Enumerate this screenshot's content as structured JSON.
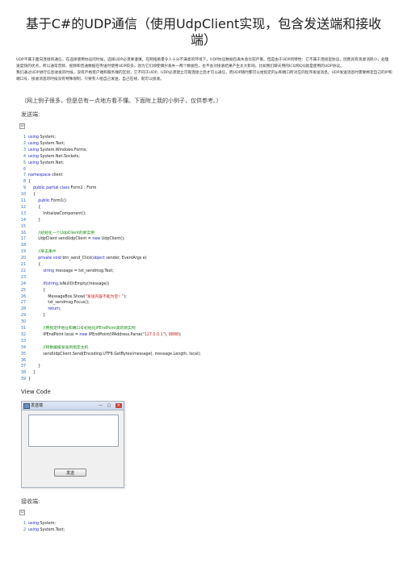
{
  "document": {
    "title": "基于C#的UDP通信（使用UdpClient实现，包含发送端和接收端）",
    "intro": [
      "UDP不属于面向连接的通信，在选择使用协议的时候，选择UDP必须要谨慎。在网络质量令人十分不满意的环境下，UDP协议数据包丢失会比较严重。但是由于UDP的特性：它不属于连接型协议，因而具有资源消耗小，处理速度快的优点，所以通常音频、视频和普通数据在传送时使用UDP较多，因为它们即使偶尔丢失一两个数据包，也不会对接收结果产生太大影响。比如我们聊天用的ICQ和QQ就是使用的UDP协议。",
      "我们通过UDP进行信息收发的时候，没有严格客户端和服务端的区别，它不同于UDP，UDP必须建立可靠连接之后才可以通信，而UDP随时都可以给指定的ip和端口所对应的程序发送消息。UDP发送消息时需要绑定自己的IP和端口号，接收消息的时候没有特殊限制，只要有人给自己发送，自己在线，就可以接收。"
    ],
    "note": "（网上例子很多，但是总有一点地方看不懂。下面附上我的小例子，仅供参考。）",
    "sender_label": "发送端:",
    "view_code": "View Code",
    "receiver_label": "接收端:",
    "collapse_symbol": "⊟"
  },
  "sender_code": [
    {
      "n": "1",
      "parts": [
        {
          "t": "kw",
          "s": "using"
        },
        {
          "t": "",
          "s": " System;"
        }
      ]
    },
    {
      "n": "2",
      "parts": [
        {
          "t": "kw",
          "s": "using"
        },
        {
          "t": "",
          "s": " System.Text;"
        }
      ]
    },
    {
      "n": "3",
      "parts": [
        {
          "t": "kw",
          "s": "using"
        },
        {
          "t": "",
          "s": " System.Windows.Forms;"
        }
      ]
    },
    {
      "n": "4",
      "parts": [
        {
          "t": "kw",
          "s": "using"
        },
        {
          "t": "",
          "s": " System.Net.Sockets;"
        }
      ]
    },
    {
      "n": "5",
      "parts": [
        {
          "t": "kw",
          "s": "using"
        },
        {
          "t": "",
          "s": " System.Net;"
        }
      ]
    },
    {
      "n": "6",
      "parts": []
    },
    {
      "n": "7",
      "parts": [
        {
          "t": "kw",
          "s": "namespace"
        },
        {
          "t": "",
          "s": " client"
        }
      ]
    },
    {
      "n": "8",
      "parts": [
        {
          "t": "",
          "s": "{"
        }
      ]
    },
    {
      "n": "9",
      "parts": [
        {
          "t": "",
          "s": "    "
        },
        {
          "t": "kw",
          "s": "public partial class"
        },
        {
          "t": "",
          "s": " Form1 : Form"
        }
      ]
    },
    {
      "n": "10",
      "parts": [
        {
          "t": "",
          "s": "    {"
        }
      ]
    },
    {
      "n": "11",
      "parts": [
        {
          "t": "",
          "s": "        "
        },
        {
          "t": "kw",
          "s": "public"
        },
        {
          "t": "",
          "s": " Form1()"
        }
      ]
    },
    {
      "n": "12",
      "parts": [
        {
          "t": "",
          "s": "        {"
        }
      ]
    },
    {
      "n": "13",
      "parts": [
        {
          "t": "",
          "s": "            InitializeComponent();"
        }
      ]
    },
    {
      "n": "14",
      "parts": [
        {
          "t": "",
          "s": "        }"
        }
      ]
    },
    {
      "n": "15",
      "parts": []
    },
    {
      "n": "16",
      "parts": [
        {
          "t": "",
          "s": "        "
        },
        {
          "t": "cm",
          "s": "//初始化一个UdpClient的新实例"
        }
      ]
    },
    {
      "n": "17",
      "parts": [
        {
          "t": "",
          "s": "        UdpClient sendUdpClient = "
        },
        {
          "t": "kw",
          "s": "new"
        },
        {
          "t": "",
          "s": " UdpClient();"
        }
      ]
    },
    {
      "n": "18",
      "parts": []
    },
    {
      "n": "19",
      "parts": [
        {
          "t": "",
          "s": "        "
        },
        {
          "t": "cm",
          "s": "//单击事件"
        }
      ]
    },
    {
      "n": "20",
      "parts": [
        {
          "t": "",
          "s": "        "
        },
        {
          "t": "kw",
          "s": "private void"
        },
        {
          "t": "",
          "s": " btn_send_Click("
        },
        {
          "t": "kw",
          "s": "object"
        },
        {
          "t": "",
          "s": " sender, EventArgs e)"
        }
      ]
    },
    {
      "n": "21",
      "parts": [
        {
          "t": "",
          "s": "        {"
        }
      ]
    },
    {
      "n": "22",
      "parts": [
        {
          "t": "",
          "s": "            "
        },
        {
          "t": "kw",
          "s": "string"
        },
        {
          "t": "",
          "s": " message = txt_sendmsg.Text;"
        }
      ]
    },
    {
      "n": "23",
      "parts": []
    },
    {
      "n": "24",
      "parts": [
        {
          "t": "",
          "s": "            "
        },
        {
          "t": "kw",
          "s": "if"
        },
        {
          "t": "",
          "s": "("
        },
        {
          "t": "kw",
          "s": "string"
        },
        {
          "t": "",
          "s": ".IsNullOrEmpty(message))"
        }
      ]
    },
    {
      "n": "25",
      "parts": [
        {
          "t": "",
          "s": "            {"
        }
      ]
    },
    {
      "n": "26",
      "parts": [
        {
          "t": "",
          "s": "                MessageBox.Show("
        },
        {
          "t": "st",
          "s": "\"发送内容不能为空！\""
        },
        {
          "t": "",
          "s": ");"
        }
      ]
    },
    {
      "n": "27",
      "parts": [
        {
          "t": "",
          "s": "                txt_sendmsg.Focus();"
        }
      ]
    },
    {
      "n": "28",
      "parts": [
        {
          "t": "",
          "s": "                "
        },
        {
          "t": "kw",
          "s": "return"
        },
        {
          "t": "",
          "s": ";"
        }
      ]
    },
    {
      "n": "29",
      "parts": [
        {
          "t": "",
          "s": "            }"
        }
      ]
    },
    {
      "n": "30",
      "parts": []
    },
    {
      "n": "31",
      "parts": [
        {
          "t": "",
          "s": "            "
        },
        {
          "t": "cm",
          "s": "//用指定IP地址和端口号初始化IPEndPoint类的新实例"
        }
      ]
    },
    {
      "n": "32",
      "parts": [
        {
          "t": "",
          "s": "            IPEndPoint local = "
        },
        {
          "t": "kw",
          "s": "new"
        },
        {
          "t": "",
          "s": " IPEndPoint(IPAddress.Parse("
        },
        {
          "t": "st",
          "s": "\"127.0.0.1\""
        },
        {
          "t": "",
          "s": "), "
        },
        {
          "t": "st",
          "s": "8888"
        },
        {
          "t": "",
          "s": ");"
        }
      ]
    },
    {
      "n": "33",
      "parts": []
    },
    {
      "n": "34",
      "parts": [
        {
          "t": "",
          "s": "            "
        },
        {
          "t": "cm",
          "s": "//将数据报发送到指定主机"
        }
      ]
    },
    {
      "n": "35",
      "parts": [
        {
          "t": "",
          "s": "            sendUdpClient.Send(Encoding.UTF8.GetBytes(message), message.Length, local);"
        }
      ]
    },
    {
      "n": "36",
      "parts": []
    },
    {
      "n": "37",
      "parts": [
        {
          "t": "",
          "s": "        }"
        }
      ]
    },
    {
      "n": "38",
      "parts": [
        {
          "t": "",
          "s": "    }"
        }
      ]
    },
    {
      "n": "39",
      "parts": [
        {
          "t": "",
          "s": "}"
        }
      ]
    }
  ],
  "sender_window": {
    "title": "发送端",
    "controls": "—  ▢",
    "close": "✕",
    "button_label": "发送"
  },
  "receiver_code": [
    {
      "n": "1",
      "parts": [
        {
          "t": "kw",
          "s": "using"
        },
        {
          "t": "",
          "s": " System;"
        }
      ]
    },
    {
      "n": "2",
      "parts": [
        {
          "t": "kw",
          "s": "using"
        },
        {
          "t": "",
          "s": " System.Text;"
        }
      ]
    }
  ]
}
